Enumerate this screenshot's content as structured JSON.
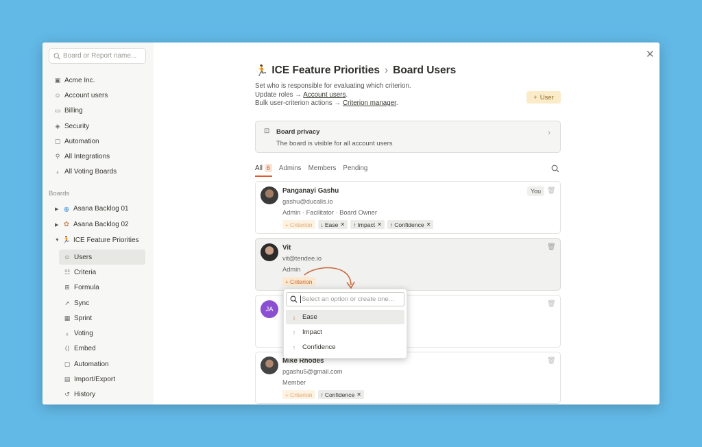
{
  "sidebar": {
    "search_placeholder": "Board or Report name...",
    "items": [
      {
        "label": "Acme Inc.",
        "icon": "building-icon"
      },
      {
        "label": "Account users",
        "icon": "users-icon"
      },
      {
        "label": "Billing",
        "icon": "card-icon"
      },
      {
        "label": "Security",
        "icon": "shield-icon"
      },
      {
        "label": "Automation",
        "icon": "robot-icon"
      },
      {
        "label": "All Integrations",
        "icon": "plug-icon"
      },
      {
        "label": "All Voting Boards",
        "icon": "bulb-icon"
      }
    ],
    "boards_label": "Boards",
    "boards": [
      {
        "label": "Asana Backlog 01",
        "icon": "asana-icon",
        "expanded": false
      },
      {
        "label": "Asana Backlog 02",
        "icon": "puzzle-icon",
        "expanded": false
      },
      {
        "label": "ICE Feature Priorities",
        "icon": "runner-icon",
        "expanded": true
      }
    ],
    "sub_items": [
      {
        "label": "Users",
        "icon": "users-icon",
        "active": true
      },
      {
        "label": "Criteria",
        "icon": "criteria-icon"
      },
      {
        "label": "Formula",
        "icon": "formula-icon"
      },
      {
        "label": "Sync",
        "icon": "rocket-icon"
      },
      {
        "label": "Sprint",
        "icon": "calendar-icon"
      },
      {
        "label": "Voting",
        "icon": "bulb-icon"
      },
      {
        "label": "Embed",
        "icon": "code-icon"
      },
      {
        "label": "Automation",
        "icon": "robot-icon"
      },
      {
        "label": "Import/Export",
        "icon": "csv-icon"
      },
      {
        "label": "History",
        "icon": "history-icon"
      }
    ]
  },
  "header": {
    "board_emoji": "🏃",
    "board_name": "ICE Feature Priorities",
    "page_name": "Board Users",
    "desc_line1": "Set who is responsible for evaluating which criterion.",
    "desc_line2_prefix": "Update roles →",
    "desc_line2_link": "Account users",
    "desc_line2_suffix": ".",
    "desc_line3_prefix": "Bulk user-criterion actions →",
    "desc_line3_link": "Criterion manager",
    "desc_line3_suffix": ".",
    "add_user_label": "User"
  },
  "privacy": {
    "title": "Board privacy",
    "subtitle": "The board is visible for all account users"
  },
  "tabs": [
    {
      "label": "All",
      "count": "6",
      "active": true
    },
    {
      "label": "Admins"
    },
    {
      "label": "Members"
    },
    {
      "label": "Pending"
    }
  ],
  "users": [
    {
      "name": "Panganayi Gashu",
      "email": "gashu@ducalis.io",
      "role": "Admin · Facilitator · Board Owner",
      "you_label": "You",
      "criterion_label": "Criterion",
      "tags": [
        "Ease",
        "Impact",
        "Confidence"
      ]
    },
    {
      "name": "Vit",
      "email": "vit@tendee.io",
      "role": "Admin",
      "criterion_label": "Criterion",
      "tags": []
    },
    {
      "initials": "JA"
    },
    {
      "name": "Mike Rhodes",
      "email": "pgashu5@gmail.com",
      "role": "Member",
      "criterion_label": "Criterion",
      "tags": [
        "Confidence"
      ]
    }
  ],
  "dropdown": {
    "placeholder": "Select an option or create one...",
    "options": [
      {
        "label": "Ease",
        "arrow": "↓"
      },
      {
        "label": "Impact",
        "arrow": "↑"
      },
      {
        "label": "Confidence",
        "arrow": "↑"
      }
    ]
  },
  "colors": {
    "background": "#62b9e6",
    "accent": "#e0592a",
    "add_user_bg": "#fbebc8"
  }
}
